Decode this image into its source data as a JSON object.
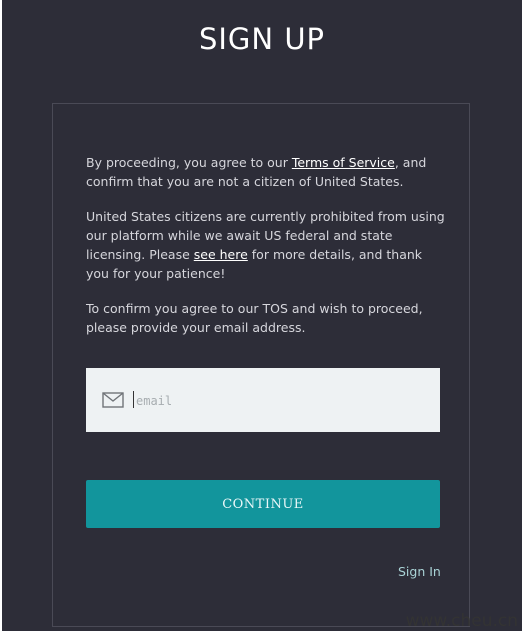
{
  "header": {
    "title": "SIGN UP"
  },
  "notice": {
    "p1_before": "By proceeding, you agree to our ",
    "tos_link": "Terms of Service",
    "p1_after": ", and confirm that you are not a citizen of United States.",
    "p2_before": "United States citizens are currently prohibited from using our platform while we await US federal and state licensing. Please ",
    "see_here_link": "see here",
    "p2_after": " for more details, and thank you for your patience!",
    "p3": "To confirm you agree to our TOS and wish to proceed, please provide your email address."
  },
  "form": {
    "email_placeholder": "email",
    "email_value": "",
    "email_icon": "mail-icon",
    "continue_label": "CONTINUE"
  },
  "footer": {
    "signin_label": "Sign In"
  },
  "watermark": "www.cheu.cn",
  "colors": {
    "background": "#2d2d38",
    "accent": "#12959c",
    "input_bg": "#eef2f3"
  }
}
